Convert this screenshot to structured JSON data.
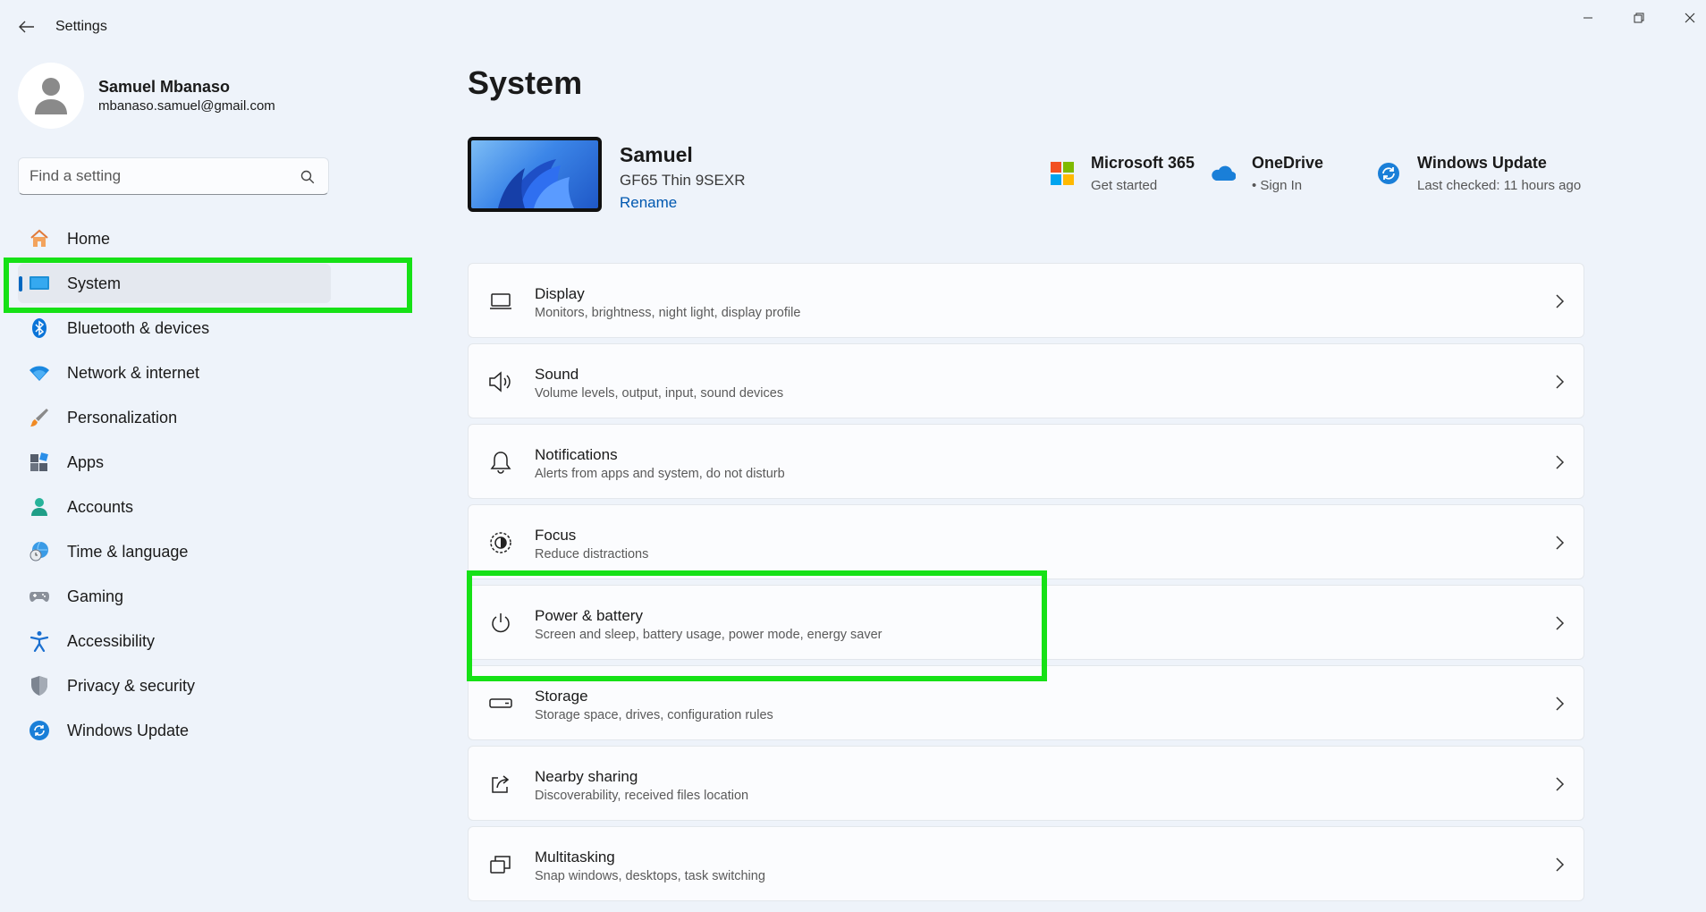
{
  "window": {
    "title": "Settings",
    "minimize_icon": "minimize-icon",
    "restore_icon": "restore-icon",
    "close_icon": "close-icon"
  },
  "profile": {
    "name": "Samuel Mbanaso",
    "email": "mbanaso.samuel@gmail.com"
  },
  "search": {
    "placeholder": "Find a setting"
  },
  "sidebar": {
    "items": [
      {
        "label": "Home",
        "icon": "home-icon",
        "active": false
      },
      {
        "label": "System",
        "icon": "system-icon",
        "active": true
      },
      {
        "label": "Bluetooth & devices",
        "icon": "bluetooth-icon",
        "active": false
      },
      {
        "label": "Network & internet",
        "icon": "wifi-icon",
        "active": false
      },
      {
        "label": "Personalization",
        "icon": "brush-icon",
        "active": false
      },
      {
        "label": "Apps",
        "icon": "apps-icon",
        "active": false
      },
      {
        "label": "Accounts",
        "icon": "person-icon",
        "active": false
      },
      {
        "label": "Time & language",
        "icon": "globe-clock-icon",
        "active": false
      },
      {
        "label": "Gaming",
        "icon": "gamepad-icon",
        "active": false
      },
      {
        "label": "Accessibility",
        "icon": "accessibility-icon",
        "active": false
      },
      {
        "label": "Privacy & security",
        "icon": "shield-icon",
        "active": false
      },
      {
        "label": "Windows Update",
        "icon": "update-icon",
        "active": false
      }
    ]
  },
  "main": {
    "title": "System",
    "device": {
      "name": "Samuel",
      "model": "GF65 Thin 9SEXR",
      "rename_label": "Rename"
    },
    "quick_links": [
      {
        "title": "Microsoft 365",
        "subtitle": "Get started",
        "icon": "microsoft-logo-icon"
      },
      {
        "title": "OneDrive",
        "subtitle": "• Sign In",
        "icon": "onedrive-cloud-icon"
      },
      {
        "title": "Windows Update",
        "subtitle": "Last checked: 11 hours ago",
        "icon": "update-icon"
      }
    ],
    "cards": [
      {
        "title": "Display",
        "subtitle": "Monitors, brightness, night light, display profile",
        "icon": "display-icon"
      },
      {
        "title": "Sound",
        "subtitle": "Volume levels, output, input, sound devices",
        "icon": "speaker-icon"
      },
      {
        "title": "Notifications",
        "subtitle": "Alerts from apps and system, do not disturb",
        "icon": "bell-icon"
      },
      {
        "title": "Focus",
        "subtitle": "Reduce distractions",
        "icon": "focus-icon"
      },
      {
        "title": "Power & battery",
        "subtitle": "Screen and sleep, battery usage, power mode, energy saver",
        "icon": "power-icon"
      },
      {
        "title": "Storage",
        "subtitle": "Storage space, drives, configuration rules",
        "icon": "storage-icon"
      },
      {
        "title": "Nearby sharing",
        "subtitle": "Discoverability, received files location",
        "icon": "share-icon"
      },
      {
        "title": "Multitasking",
        "subtitle": "Snap windows, desktops, task switching",
        "icon": "multitask-icon"
      }
    ]
  },
  "colors": {
    "accent": "#0067c0",
    "highlight": "#16e116",
    "background": "#eef3fa"
  }
}
